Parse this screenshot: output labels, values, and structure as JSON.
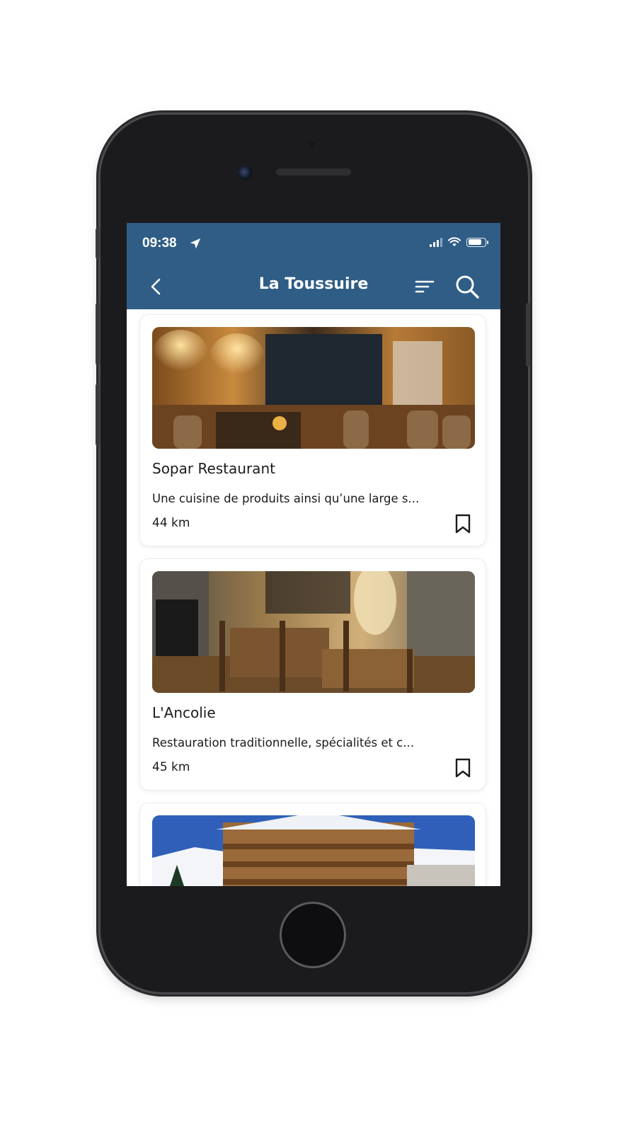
{
  "status_bar": {
    "time": "09:38",
    "location_icon": "location-arrow-icon",
    "signal_icon": "cellular-signal-icon",
    "wifi_icon": "wifi-icon",
    "battery_icon": "battery-icon",
    "battery_level": 0.85
  },
  "header": {
    "title": "La Toussuire",
    "back_icon": "chevron-left-icon",
    "sort_icon": "sort-icon",
    "search_icon": "search-icon",
    "background_color": "#2f5d86"
  },
  "listings": [
    {
      "name": "Sopar Restaurant",
      "description": "Une cuisine de produits ainsi qu’une large s...",
      "distance": "44 km",
      "image": "restaurant-interior-warm-wood-photo",
      "bookmark_icon": "bookmark-icon"
    },
    {
      "name": "L'Ancolie",
      "description": "Restauration traditionnelle, spécialités et c...",
      "distance": "45 km",
      "image": "restaurant-interior-stone-wall-photo",
      "bookmark_icon": "bookmark-icon"
    },
    {
      "name": "",
      "description": "",
      "distance": "",
      "image": "mountain-chalet-hotel-photo",
      "bookmark_icon": "bookmark-icon"
    }
  ]
}
